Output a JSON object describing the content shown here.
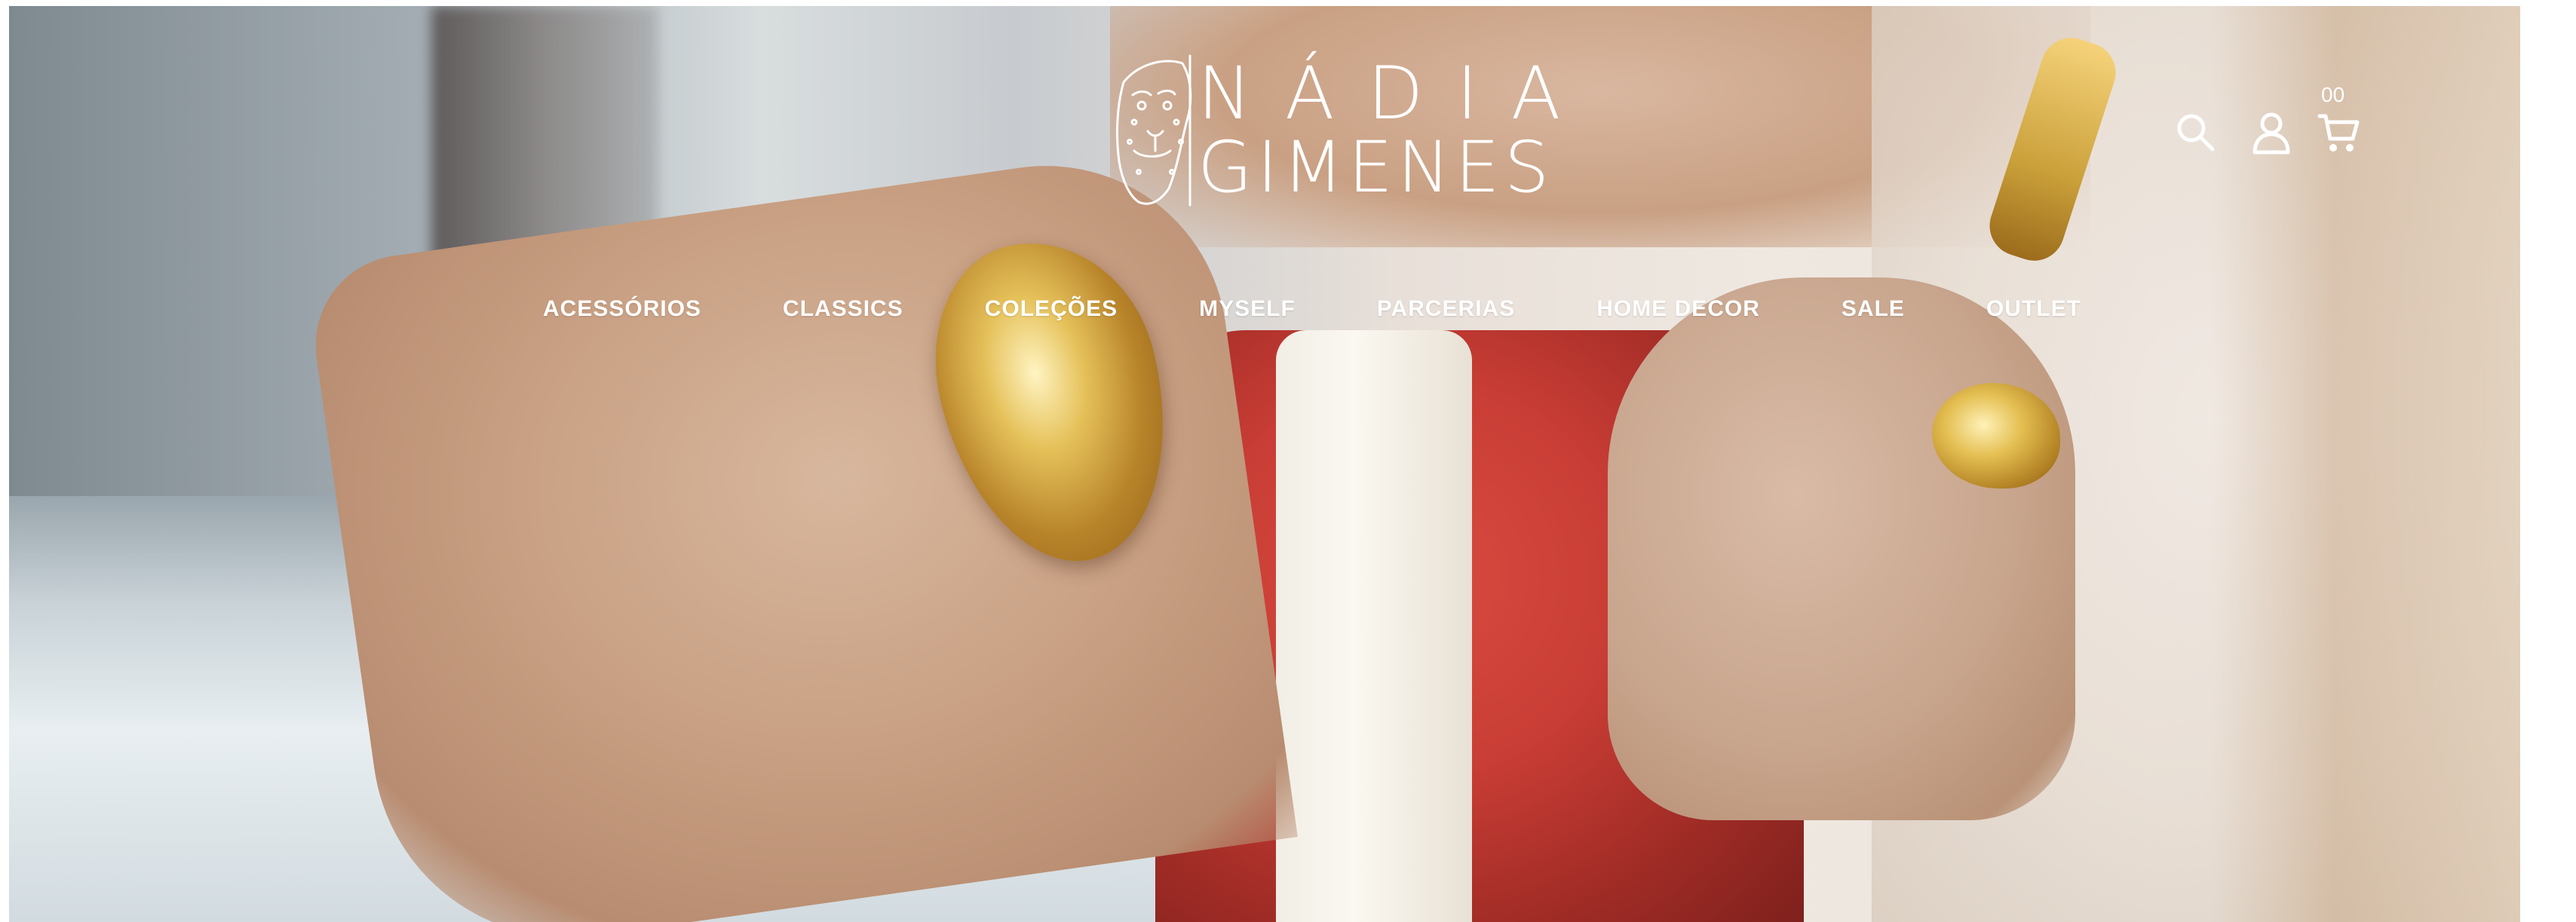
{
  "brand": {
    "line1": "NÁDIA",
    "line2": "GIMENES",
    "logo_icon": "leopard-head-icon"
  },
  "nav": {
    "items": [
      {
        "label": "ACESSÓRIOS"
      },
      {
        "label": "CLASSICS"
      },
      {
        "label": "COLEÇÕES"
      },
      {
        "label": "MYSELF"
      },
      {
        "label": "PARCERIAS"
      },
      {
        "label": "HOME DECOR"
      },
      {
        "label": "SALE"
      },
      {
        "label": "OUTLET"
      }
    ]
  },
  "header_actions": {
    "search_icon": "search-icon",
    "account_icon": "user-icon",
    "cart_icon": "cart-icon",
    "cart_count": "00"
  },
  "colors": {
    "nav_text": "#ffffff",
    "logo": "#ffffff",
    "gold_accent": "#d4aa3a",
    "seat_red": "#c83d35"
  }
}
